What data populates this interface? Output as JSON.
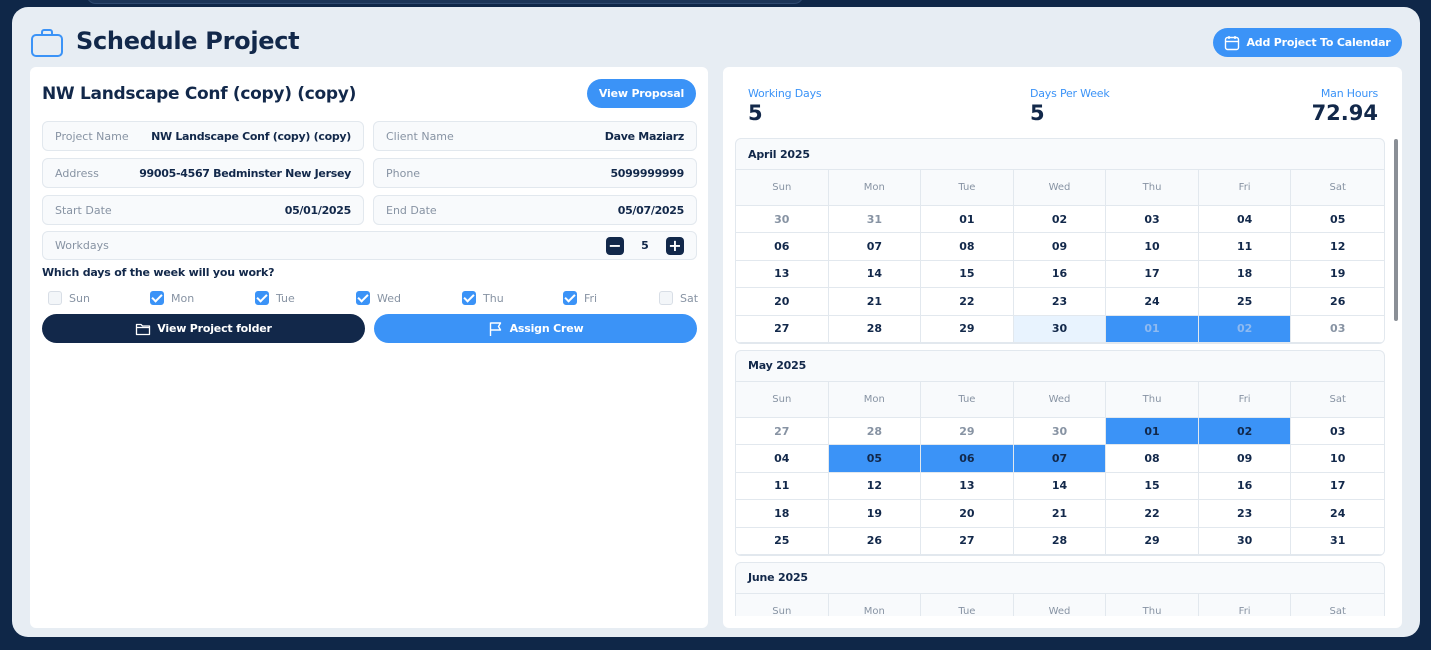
{
  "header": {
    "title": "Schedule Project",
    "add_calendar_label": "Add Project To Calendar"
  },
  "project": {
    "title": "NW Landscape Conf (copy) (copy)",
    "proposal_label": "View Proposal",
    "fields": {
      "project_name": {
        "label": "Project Name",
        "value": "NW Landscape Conf (copy) (copy)"
      },
      "client_name": {
        "label": "Client Name",
        "value": "Dave Maziarz"
      },
      "address": {
        "label": "Address",
        "value": "99005-4567 Bedminster New Jersey"
      },
      "phone": {
        "label": "Phone",
        "value": "5099999999"
      },
      "start_date": {
        "label": "Start Date",
        "value": "05/01/2025"
      },
      "end_date": {
        "label": "End Date",
        "value": "05/07/2025"
      },
      "workdays": {
        "label": "Workdays",
        "value": "5"
      }
    },
    "days_question": "Which days of the week will you work?",
    "days": [
      {
        "label": "Sun",
        "checked": false
      },
      {
        "label": "Mon",
        "checked": true
      },
      {
        "label": "Tue",
        "checked": true
      },
      {
        "label": "Wed",
        "checked": true
      },
      {
        "label": "Thu",
        "checked": true
      },
      {
        "label": "Fri",
        "checked": true
      },
      {
        "label": "Sat",
        "checked": false
      }
    ],
    "folder_label": "View Project folder",
    "crew_label": "Assign Crew"
  },
  "stats": {
    "working_days": {
      "label": "Working Days",
      "value": "5"
    },
    "days_per_week": {
      "label": "Days Per Week",
      "value": "5"
    },
    "man_hours": {
      "label": "Man Hours",
      "value": "72.94"
    }
  },
  "calendar": {
    "weekdays": [
      "Sun",
      "Mon",
      "Tue",
      "Wed",
      "Thu",
      "Fri",
      "Sat"
    ],
    "months": [
      {
        "title": "April 2025",
        "weeks": [
          [
            {
              "d": "30",
              "o": true
            },
            {
              "d": "31",
              "o": true
            },
            {
              "d": "01"
            },
            {
              "d": "02"
            },
            {
              "d": "03"
            },
            {
              "d": "04"
            },
            {
              "d": "05"
            }
          ],
          [
            {
              "d": "06"
            },
            {
              "d": "07"
            },
            {
              "d": "08"
            },
            {
              "d": "09"
            },
            {
              "d": "10"
            },
            {
              "d": "11"
            },
            {
              "d": "12"
            }
          ],
          [
            {
              "d": "13"
            },
            {
              "d": "14"
            },
            {
              "d": "15"
            },
            {
              "d": "16"
            },
            {
              "d": "17"
            },
            {
              "d": "18"
            },
            {
              "d": "19"
            }
          ],
          [
            {
              "d": "20"
            },
            {
              "d": "21"
            },
            {
              "d": "22"
            },
            {
              "d": "23"
            },
            {
              "d": "24"
            },
            {
              "d": "25"
            },
            {
              "d": "26"
            }
          ],
          [
            {
              "d": "27"
            },
            {
              "d": "28"
            },
            {
              "d": "29"
            },
            {
              "d": "30",
              "t": true
            },
            {
              "d": "01",
              "o": true,
              "s": true
            },
            {
              "d": "02",
              "o": true,
              "s": true
            },
            {
              "d": "03",
              "o": true
            }
          ]
        ]
      },
      {
        "title": "May 2025",
        "weeks": [
          [
            {
              "d": "27",
              "o": true
            },
            {
              "d": "28",
              "o": true
            },
            {
              "d": "29",
              "o": true
            },
            {
              "d": "30",
              "o": true
            },
            {
              "d": "01",
              "s": true
            },
            {
              "d": "02",
              "s": true
            },
            {
              "d": "03"
            }
          ],
          [
            {
              "d": "04"
            },
            {
              "d": "05",
              "s": true
            },
            {
              "d": "06",
              "s": true
            },
            {
              "d": "07",
              "s": true
            },
            {
              "d": "08"
            },
            {
              "d": "09"
            },
            {
              "d": "10"
            }
          ],
          [
            {
              "d": "11"
            },
            {
              "d": "12"
            },
            {
              "d": "13"
            },
            {
              "d": "14"
            },
            {
              "d": "15"
            },
            {
              "d": "16"
            },
            {
              "d": "17"
            }
          ],
          [
            {
              "d": "18"
            },
            {
              "d": "19"
            },
            {
              "d": "20"
            },
            {
              "d": "21"
            },
            {
              "d": "22"
            },
            {
              "d": "23"
            },
            {
              "d": "24"
            }
          ],
          [
            {
              "d": "25"
            },
            {
              "d": "26"
            },
            {
              "d": "27"
            },
            {
              "d": "28"
            },
            {
              "d": "29"
            },
            {
              "d": "30"
            },
            {
              "d": "31"
            }
          ]
        ]
      },
      {
        "title": "June 2025",
        "weeks": []
      }
    ]
  },
  "colors": {
    "accent": "#3b93f7",
    "navy": "#12284a",
    "background": "#0f2748",
    "modal": "#e7edf3"
  }
}
